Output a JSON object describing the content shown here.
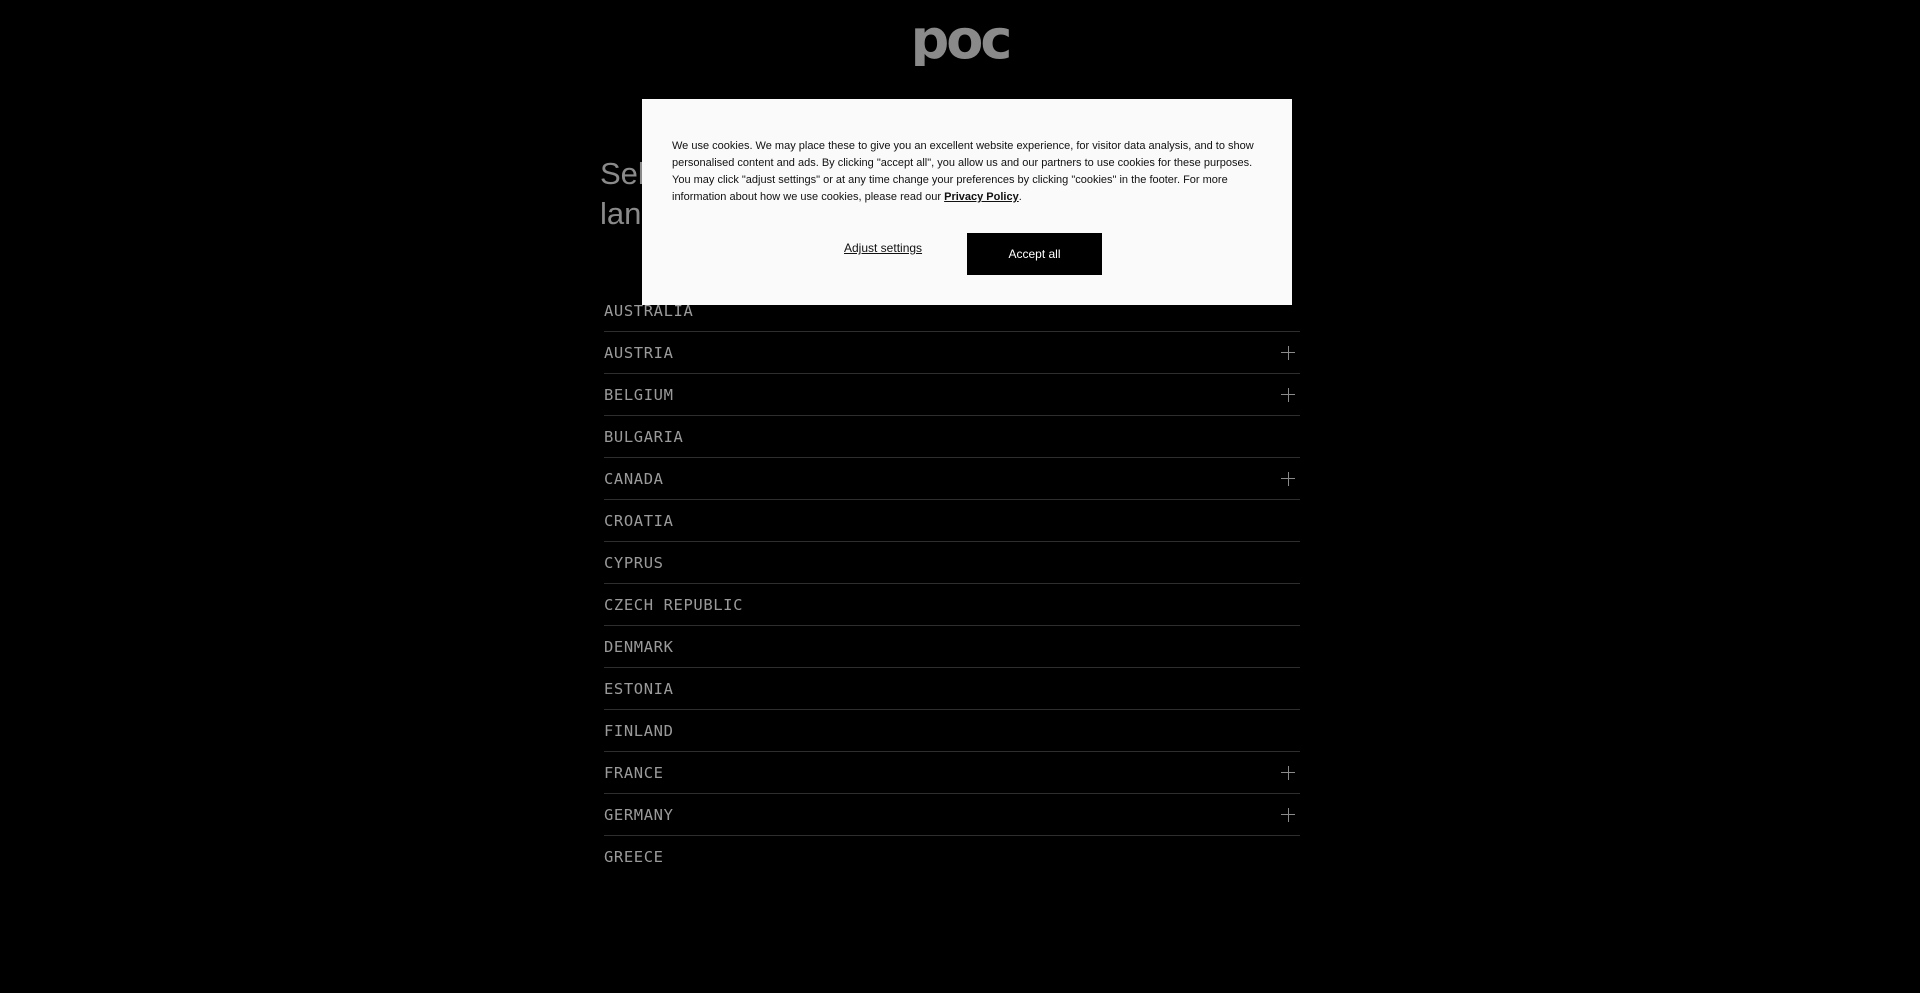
{
  "brand": {
    "logo_text": "poc",
    "logo_color": "#8a8a8a"
  },
  "heading": {
    "line1": "Sel",
    "line2": "lan"
  },
  "countries": [
    {
      "label": "AUSTRALIA",
      "expandable": false
    },
    {
      "label": "AUSTRIA",
      "expandable": true
    },
    {
      "label": "BELGIUM",
      "expandable": true
    },
    {
      "label": "BULGARIA",
      "expandable": false
    },
    {
      "label": "CANADA",
      "expandable": true
    },
    {
      "label": "CROATIA",
      "expandable": false
    },
    {
      "label": "CYPRUS",
      "expandable": false
    },
    {
      "label": "CZECH REPUBLIC",
      "expandable": false
    },
    {
      "label": "DENMARK",
      "expandable": false
    },
    {
      "label": "ESTONIA",
      "expandable": false
    },
    {
      "label": "FINLAND",
      "expandable": false
    },
    {
      "label": "FRANCE",
      "expandable": true
    },
    {
      "label": "GERMANY",
      "expandable": true
    },
    {
      "label": "GREECE",
      "expandable": false
    }
  ],
  "cookie_dialog": {
    "text_before_link": "We use cookies. We may place these to give you an excellent website experience, for visitor data analysis, and to show personalised content and ads. By clicking \"accept all\", you allow us and our partners to use cookies for these purposes. You may click \"adjust settings\" or at any time change your preferences by clicking \"cookies\" in the footer. For more information about how we use cookies, please read our ",
    "privacy_link_label": "Privacy Policy",
    "text_after_link": ".",
    "adjust_label": "Adjust settings",
    "accept_label": "Accept all"
  },
  "icons": {
    "expand": "plus-icon"
  }
}
